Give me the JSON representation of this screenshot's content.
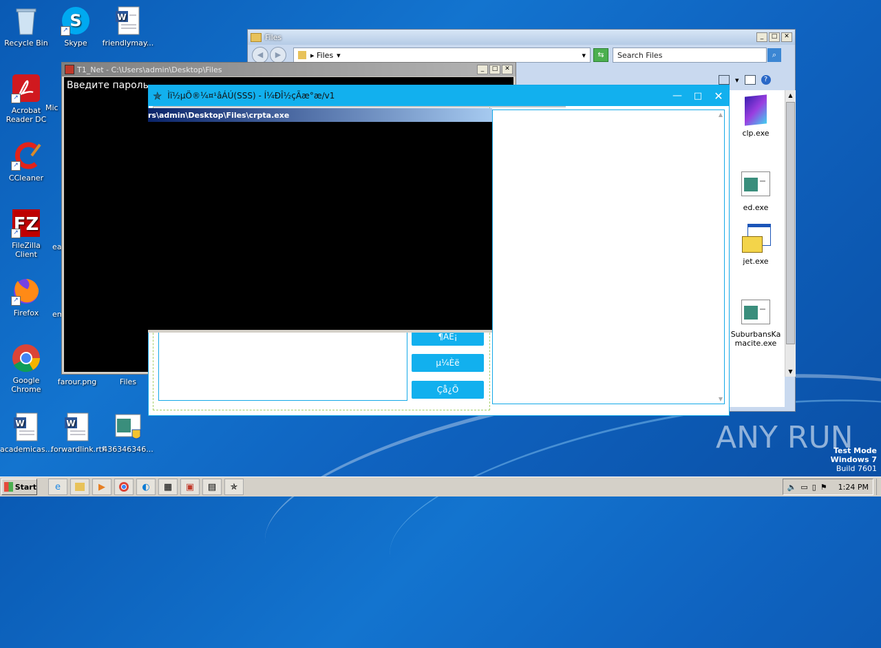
{
  "desktop": {
    "icons": [
      {
        "label": "Recycle Bin"
      },
      {
        "label": "Skype"
      },
      {
        "label": "friendlymay..."
      },
      {
        "label": "Acrobat Reader DC"
      },
      {
        "label": "Mic"
      },
      {
        "label": "CCleaner"
      },
      {
        "label": "FileZilla Client"
      },
      {
        "label": "ea"
      },
      {
        "label": "Firefox"
      },
      {
        "label": "em"
      },
      {
        "label": "Google Chrome"
      },
      {
        "label": "farour.png"
      },
      {
        "label": "Files"
      },
      {
        "label": "academicas..."
      },
      {
        "label": "forwardlink.rtf"
      },
      {
        "label": "436346346..."
      }
    ]
  },
  "explorer": {
    "title": "Files",
    "breadcrumb": "Files",
    "search_placeholder": "Search Files",
    "files": [
      {
        "label": "clp.exe"
      },
      {
        "label": "ed.exe"
      },
      {
        "label": "jet.exe"
      },
      {
        "label": "SuburbansKamacite.exe"
      }
    ]
  },
  "console1": {
    "title": "T1_Net - C:\\Users\\admin\\Desktop\\Files",
    "text": "Введите пароль ."
  },
  "app": {
    "title": "Ìï½µÖ®¼¤¹âÁÚ(SSS) - Í¼ÐÎ½çÃæ°æ/v1",
    "buttons": [
      "¶ÁÈ¡",
      "µ¼Èë",
      "Çå¿Õ"
    ]
  },
  "console2": {
    "title": "rs\\admin\\Desktop\\Files\\crpta.exe"
  },
  "watermark": {
    "brand": "ANY RUN"
  },
  "os": {
    "line1": "Test Mode",
    "line2": "Windows 7",
    "line3": "Build 7601"
  },
  "taskbar": {
    "start": "Start",
    "clock": "1:24 PM"
  }
}
